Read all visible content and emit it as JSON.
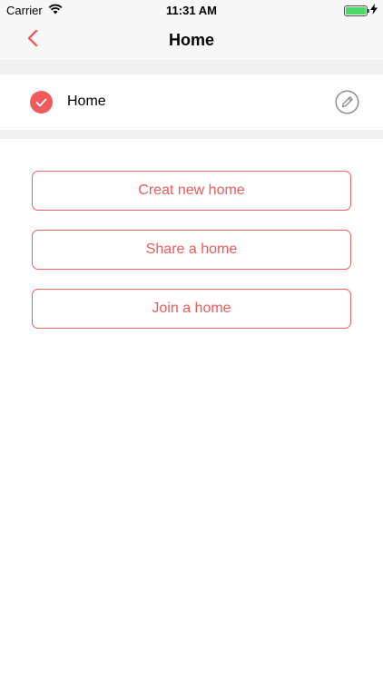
{
  "status_bar": {
    "carrier": "Carrier",
    "time": "11:31 AM",
    "battery_level": 1.0,
    "charging": true
  },
  "nav": {
    "title": "Home",
    "back_icon": "chevron-left-icon"
  },
  "homes": [
    {
      "name": "Home",
      "selected": true
    }
  ],
  "actions": {
    "create": "Creat new home",
    "share": "Share a home",
    "join": "Join a home"
  },
  "colors": {
    "accent": "#ef5a5a",
    "battery": "#4cd964",
    "edit_icon": "#8e8e93"
  }
}
